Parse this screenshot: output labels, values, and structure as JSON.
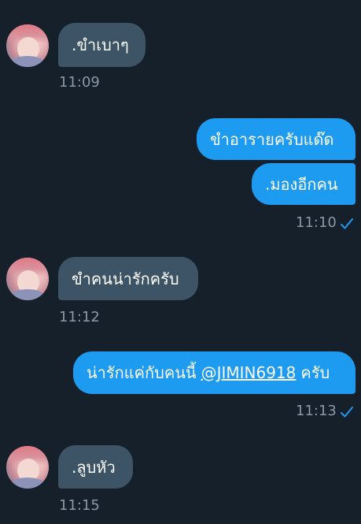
{
  "messages": [
    {
      "side": "in",
      "text": ".ขำเบาๆ",
      "time": "11:09"
    },
    {
      "side": "out",
      "text": "ขำอารายครับแด๊ด"
    },
    {
      "side": "out",
      "text": ".มองอีกคน",
      "time": "11:10"
    },
    {
      "side": "in",
      "text": "ขำคนน่ารักครับ",
      "time": "11:12"
    },
    {
      "side": "out",
      "text_before": "น่ารักแค่กับคนนี้",
      "mention": "@JIMIN6918",
      "text_after": "ครับ",
      "time": "11:13"
    },
    {
      "side": "in",
      "text": ".ลูบหัว",
      "time": "11:15"
    }
  ],
  "icons": {
    "read_receipt": "checkmark-icon",
    "avatar": "profile-avatar"
  },
  "colors": {
    "background": "#15202b",
    "incoming_bubble": "#3d5466",
    "outgoing_bubble": "#1d9bf0",
    "timestamp": "#8b98a5",
    "check": "#1d9bf0"
  }
}
